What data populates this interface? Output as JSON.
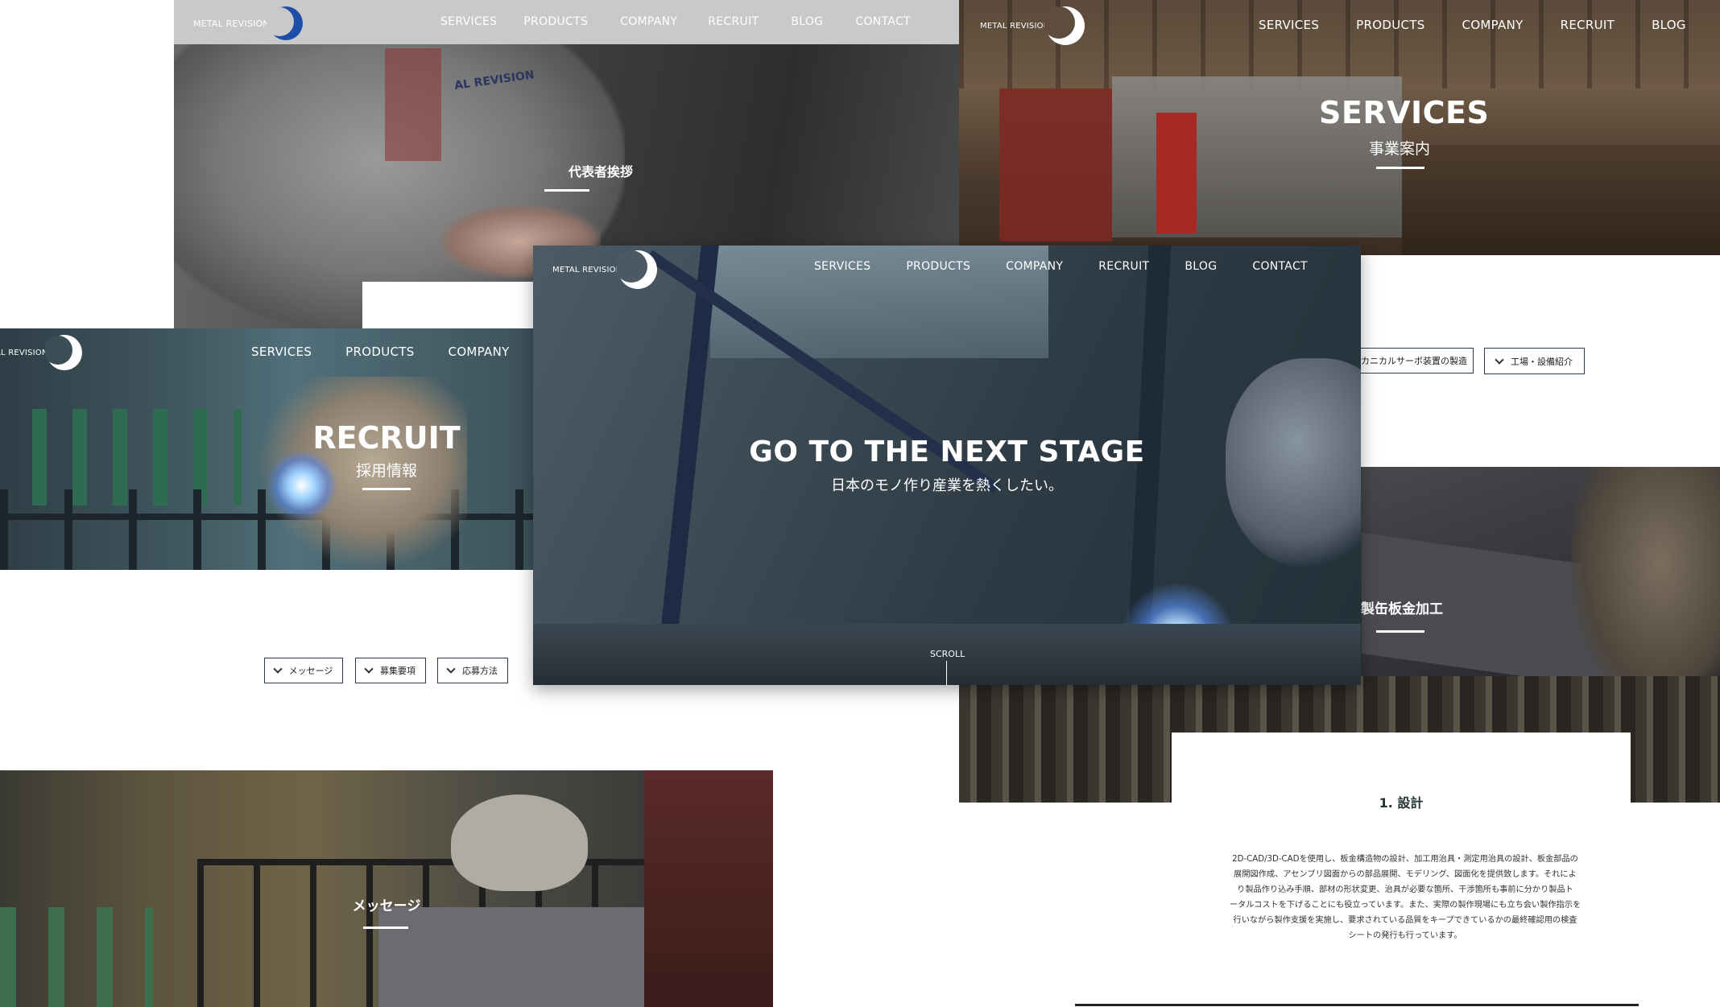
{
  "brand": {
    "logo_text": "METAL REVISION",
    "logo_text_cut": "AL REVISION"
  },
  "nav": {
    "services": "SERVICES",
    "products": "PRODUCTS",
    "company": "COMPANY",
    "recruit": "RECRUIT",
    "blog": "BLOG",
    "contact": "CONTACT"
  },
  "greeting_page": {
    "heading": "代表者挨拶",
    "jacket_text": "AL REVISION"
  },
  "services_page": {
    "title": "SERVICES",
    "subtitle": "事業案内",
    "anchor_buttons": [
      "カニカルサーボ装置の製造",
      "工場・設備紹介"
    ],
    "section_heading": "製缶板金加工",
    "step_title": "1. 設計",
    "step_body_lines": [
      "2D-CAD/3D-CADを使用し、板金構造物の設計、加工用治具・測定用治具の設計、板金部品の",
      "展開図作成、アセンブリ図面からの部品展開、モデリング、図面化を提供致します。それによ",
      "り製品作り込み手順、部材の形状変更、治具が必要な箇所、干渉箇所も事前に分かり製品ト",
      "ータルコストを下げることにも役立っています。また、実際の製作現場にも立ち会い製作指示を",
      "行いながら製作支援を実施し、要求されている品質をキープできているかの最終確認用の検査",
      "シートの発行も行っています。"
    ]
  },
  "recruit_page": {
    "title": "RECRUIT",
    "subtitle": "採用情報",
    "anchor_buttons": [
      "メッセージ",
      "募集要項",
      "応募方法"
    ],
    "message_heading": "メッセージ"
  },
  "home_page": {
    "headline": "GO TO THE NEXT STAGE",
    "tagline": "日本のモノ作り産業を熱くしたい。",
    "scroll_label": "SCROLL"
  },
  "colors": {
    "nav_bar_gray": "#c9c9c9",
    "button_border": "#2b3a4a",
    "moon_blue": "#1f4ea8",
    "white": "#ffffff"
  }
}
